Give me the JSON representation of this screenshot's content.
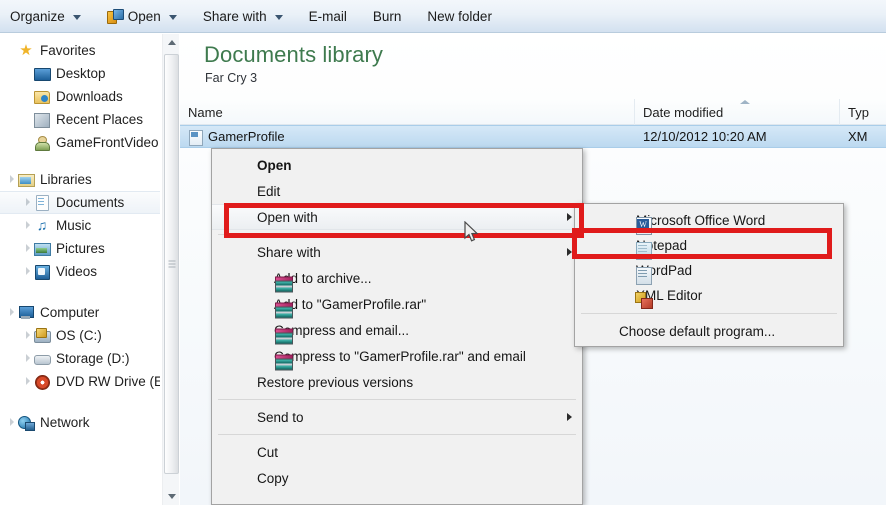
{
  "toolbar": {
    "items": [
      {
        "label": "Organize",
        "caret": true,
        "icon": null
      },
      {
        "label": "Open",
        "caret": true,
        "icon": "open-with-icon"
      },
      {
        "label": "Share with",
        "caret": true,
        "icon": null
      },
      {
        "label": "E-mail",
        "caret": false,
        "icon": null
      },
      {
        "label": "Burn",
        "caret": false,
        "icon": null
      },
      {
        "label": "New folder",
        "caret": false,
        "icon": null
      }
    ]
  },
  "navigation": {
    "groups": [
      {
        "header": {
          "label": "Favorites",
          "icon": "star-icon"
        },
        "items": [
          {
            "label": "Desktop",
            "icon": "desktop-icon"
          },
          {
            "label": "Downloads",
            "icon": "downloads-folder-icon"
          },
          {
            "label": "Recent Places",
            "icon": "recent-places-icon"
          },
          {
            "label": "GameFrontVideo",
            "icon": "user-folder-icon"
          }
        ]
      },
      {
        "header": {
          "label": "Libraries",
          "icon": "libraries-icon"
        },
        "items": [
          {
            "label": "Documents",
            "icon": "documents-icon",
            "selected": true
          },
          {
            "label": "Music",
            "icon": "music-icon"
          },
          {
            "label": "Pictures",
            "icon": "pictures-icon"
          },
          {
            "label": "Videos",
            "icon": "videos-icon"
          }
        ]
      },
      {
        "header": {
          "label": "Computer",
          "icon": "computer-icon"
        },
        "items": [
          {
            "label": "OS (C:)",
            "icon": "os-drive-icon"
          },
          {
            "label": "Storage (D:)",
            "icon": "hard-drive-icon"
          },
          {
            "label": "DVD RW Drive (E:",
            "icon": "dvd-drive-icon"
          }
        ]
      },
      {
        "header": {
          "label": "Network",
          "icon": "network-icon"
        },
        "items": []
      }
    ]
  },
  "content": {
    "library_title": "Documents library",
    "library_subtitle": "Far Cry 3",
    "columns": [
      {
        "key": "name",
        "label": "Name"
      },
      {
        "key": "date",
        "label": "Date modified"
      },
      {
        "key": "type",
        "label": "Typ"
      }
    ],
    "rows": [
      {
        "name": "GamerProfile",
        "date": "12/10/2012 10:20 AM",
        "type": "XM",
        "icon": "xml-file-icon",
        "selected": true
      }
    ]
  },
  "context_menu": {
    "items": [
      {
        "label": "Open",
        "bold": true,
        "icon": null,
        "submenu": false
      },
      {
        "label": "Edit",
        "bold": false,
        "icon": null,
        "submenu": false
      },
      {
        "label": "Open with",
        "bold": false,
        "icon": null,
        "submenu": true,
        "highlighted": true
      },
      {
        "separator": true
      },
      {
        "label": "Share with",
        "bold": false,
        "icon": null,
        "submenu": true
      },
      {
        "label": "Add to archive...",
        "bold": false,
        "icon": "winrar-icon",
        "submenu": false
      },
      {
        "label": "Add to \"GamerProfile.rar\"",
        "bold": false,
        "icon": "winrar-icon",
        "submenu": false
      },
      {
        "label": "Compress and email...",
        "bold": false,
        "icon": "winrar-icon",
        "submenu": false
      },
      {
        "label": "Compress to \"GamerProfile.rar\" and email",
        "bold": false,
        "icon": "winrar-icon",
        "submenu": false
      },
      {
        "label": "Restore previous versions",
        "bold": false,
        "icon": null,
        "submenu": false
      },
      {
        "separator": true
      },
      {
        "label": "Send to",
        "bold": false,
        "icon": null,
        "submenu": true
      },
      {
        "separator": true
      },
      {
        "label": "Cut",
        "bold": false,
        "icon": null,
        "submenu": false
      },
      {
        "label": "Copy",
        "bold": false,
        "icon": null,
        "submenu": false
      }
    ]
  },
  "open_with_submenu": {
    "items": [
      {
        "label": "Microsoft Office Word",
        "icon": "word-icon"
      },
      {
        "label": "Notepad",
        "icon": "notepad-icon",
        "highlighted": true
      },
      {
        "label": "WordPad",
        "icon": "wordpad-icon"
      },
      {
        "label": "XML Editor",
        "icon": "xml-editor-icon"
      },
      {
        "separator": true
      },
      {
        "label": "Choose default program...",
        "icon": null
      }
    ]
  },
  "annotations": {
    "color": "#e01b1b",
    "boxes": [
      {
        "target": "Open with"
      },
      {
        "target": "Notepad"
      }
    ]
  },
  "colors": {
    "title_green": "#3e7a4e",
    "selection_blue": "#bcd9f0",
    "toolbar_blue": "#dfe9f4",
    "annotation_red": "#e01b1b"
  }
}
